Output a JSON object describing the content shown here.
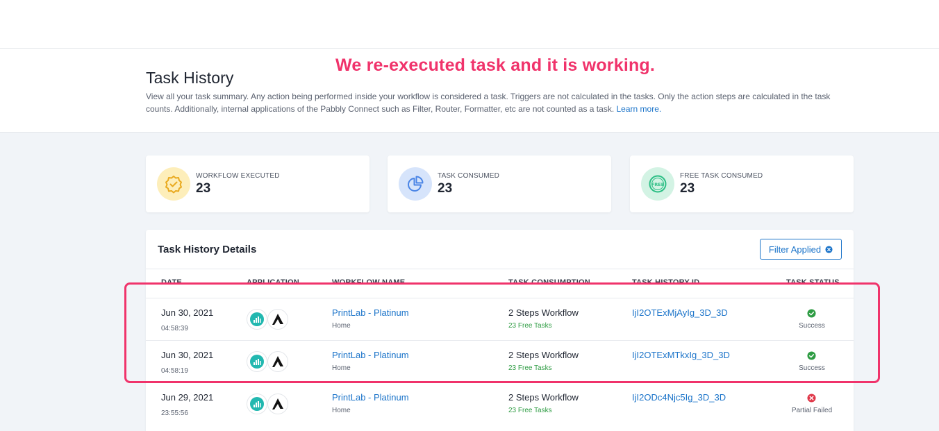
{
  "annotation": "We re-executed task and it is working.",
  "header": {
    "title": "Task History",
    "description": "View all your task summary. Any action being performed inside your workflow is considered a task. Triggers are not calculated in the tasks. Only the action steps are calculated in the task counts. Additionally, internal applications of the Pabbly Connect such as Filter, Router, Formatter, etc are not counted as a task.",
    "learn_more": "Learn more."
  },
  "stats": [
    {
      "label": "WORKFLOW EXECUTED",
      "value": "23",
      "icon": "badge-check-icon",
      "color": "#fdeeba"
    },
    {
      "label": "TASK CONSUMED",
      "value": "23",
      "icon": "pie-chart-icon",
      "color": "#d6e4fb"
    },
    {
      "label": "FREE TASK CONSUMED",
      "value": "23",
      "icon": "free-badge-icon",
      "color": "#d3f3e4"
    }
  ],
  "panel": {
    "title": "Task History Details",
    "filter_label": "Filter Applied"
  },
  "columns": [
    "DATE",
    "APPLICATION",
    "WORKFLOW NAME",
    "TASK CONSUMPTION",
    "TASK HISTORY ID",
    "TASK STATUS"
  ],
  "rows": [
    {
      "date": "Jun 30, 2021",
      "time": "04:58:39",
      "workflow": "PrintLab - Platinum",
      "folder": "Home",
      "consumption": "2 Steps Workflow",
      "free_tasks": "23 Free Tasks",
      "history_id": "IjI2OTExMjAyIg_3D_3D",
      "status": "Success",
      "status_color": "#2e9c43"
    },
    {
      "date": "Jun 30, 2021",
      "time": "04:58:19",
      "workflow": "PrintLab - Platinum",
      "folder": "Home",
      "consumption": "2 Steps Workflow",
      "free_tasks": "23 Free Tasks",
      "history_id": "IjI2OTExMTkxIg_3D_3D",
      "status": "Success",
      "status_color": "#2e9c43"
    },
    {
      "date": "Jun 29, 2021",
      "time": "23:55:56",
      "workflow": "PrintLab - Platinum",
      "folder": "Home",
      "consumption": "2 Steps Workflow",
      "free_tasks": "23 Free Tasks",
      "history_id": "IjI2ODc4Njc5Ig_3D_3D",
      "status": "Partial Failed",
      "status_color": "#e0394a"
    }
  ]
}
